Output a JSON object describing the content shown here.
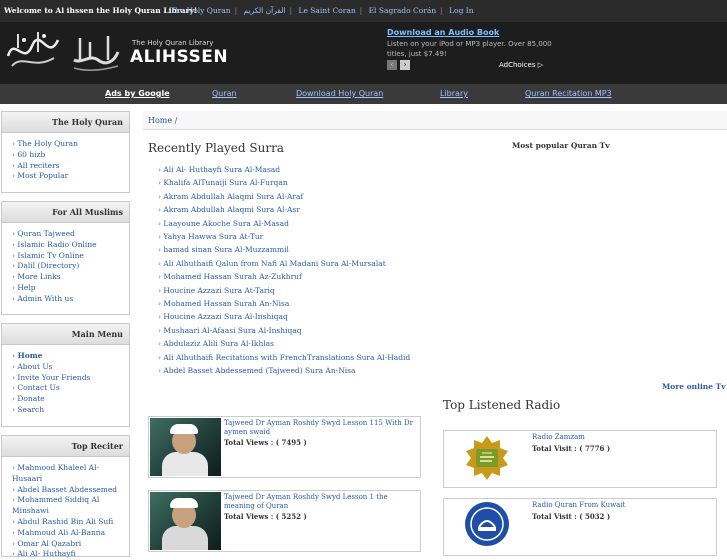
{
  "topbar": {
    "welcome": "Welcome to Al ihssen the Holy Quran Library!",
    "links": [
      "The Holy Quran",
      "القرآن الكريم",
      "Le Saint Coran",
      "El Sagrado Corán",
      "Log In"
    ]
  },
  "header": {
    "logo_sub": "The Holy Quran Library",
    "logo_main": "ALIHSSEN",
    "ad_title": "Download an Audio Book",
    "ad_text": "Listen on your iPod or MP3 player. Over 85,000 titles, just $7.49!",
    "adchoices": "AdChoices ▷"
  },
  "nav": {
    "ads": "Ads by Google",
    "items": [
      "Quran",
      "Download Holy Quran",
      "Library",
      "Quran Recitation MP3"
    ]
  },
  "sidebar": {
    "boxes": [
      {
        "title": "The Holy Quran",
        "items": [
          "The Holy Quran",
          "60 hizb",
          "All reciters",
          "Most Popular"
        ]
      },
      {
        "title": "For All Muslims",
        "items": [
          "Quran Tajweed",
          "Islamic Radio Online",
          "Islamic Tv Online",
          "Dalil (Directory)",
          "More Links",
          "Help",
          "Admin With us"
        ]
      },
      {
        "title": "Main Menu",
        "items": [
          "Home",
          "About Us",
          "Invite Your Friends",
          "Contact Us",
          "Donate",
          "Search"
        ]
      },
      {
        "title": "Top Reciter",
        "items": [
          "Mahmood Khaleel Al-Husaari",
          "Abdel Basset Abdessemed",
          "Mohammed Siddiq Al Minshawi",
          "Abdul Rashid Bin Ali Sufi",
          "Mahmoud Ali Al-Banna",
          "Omar Al Qazabri",
          "Ali Al- Huthayfi"
        ]
      }
    ]
  },
  "main": {
    "breadcrumb": "Home /",
    "recent_title": "Recently Played Surra",
    "recent": [
      "Ali Al- Huthayfi Sura Al-Masad",
      "Khalifa AlTunaiji Sura Al-Furqan",
      "Akram Abdullah Alaqmi Sura Al-Araf",
      "Akram Abdullah Alaqmi Sura Al-Asr",
      "Laayoune Akoche Sura Al-Masad",
      "Yahya Hawwa Sura At-Tur",
      "hamad sinan Sura Al-Muzzammil",
      "Ali Alhuthaifi Qalun from Nafi Al Madani Sura Al-Mursalat",
      "Mohamed Hassan Surah Az-Zukhruf",
      "Houcine Azzazi Sura At-Tariq",
      "Mohamed Hassan Surah An-Nisa",
      "Houcine Azzazi Sura Al-Inshiqaq",
      "Mushaari Al-Afaasi Sura Al-Inshiqaq",
      "Abdulaziz Alili Sura Al-Ikhlas",
      "Ali Alhuthaifi Recitations with FrenchTranslations Sura Al-Hadid",
      "Abdel Basset Abdessemed (Tajweed) Sura An-Nisa"
    ],
    "tv_title": "Most popular Quran Tv",
    "more_tv": "More online Tv",
    "videos": [
      {
        "title": "Tajweed Dr Ayman Roshdy Swyd Lesson 115 With Dr aymen swaid",
        "views": "Total Views : ( 7495 )"
      },
      {
        "title": "Tajweed Dr Ayman Roshdy Swyd Lesson 1 the meaning of Quran",
        "views": "Total Views : ( 5252 )"
      }
    ],
    "radio_title": "Top Listened Radio",
    "radios": [
      {
        "title": "Radio Zamzam",
        "visits": "Total Visit : ( 7776 )"
      },
      {
        "title": "Radio Quran From Kuwait",
        "visits": "Total Visit : ( 5032 )"
      }
    ]
  }
}
